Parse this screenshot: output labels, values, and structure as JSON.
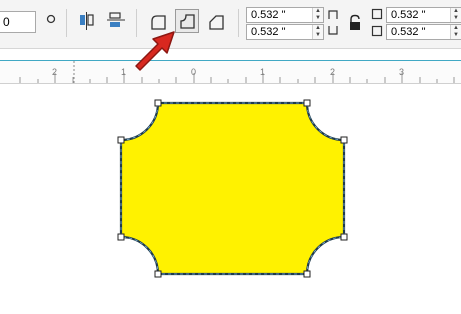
{
  "toolbar": {
    "left_value": "0",
    "radius_fields": {
      "top_left": "0.532 \"",
      "bottom_left": "0.532 \"",
      "top_right": "0.532 \"",
      "bottom_right": "0.532 \""
    }
  },
  "ruler": {
    "labels": [
      "2",
      "1",
      "0",
      "1",
      "2",
      "3"
    ]
  },
  "colors": {
    "shape_fill": "#fff200",
    "shape_stroke": "#1f3b4d",
    "pointer_arrow": "#d8281f",
    "ruler_accent": "#40a8c4"
  }
}
